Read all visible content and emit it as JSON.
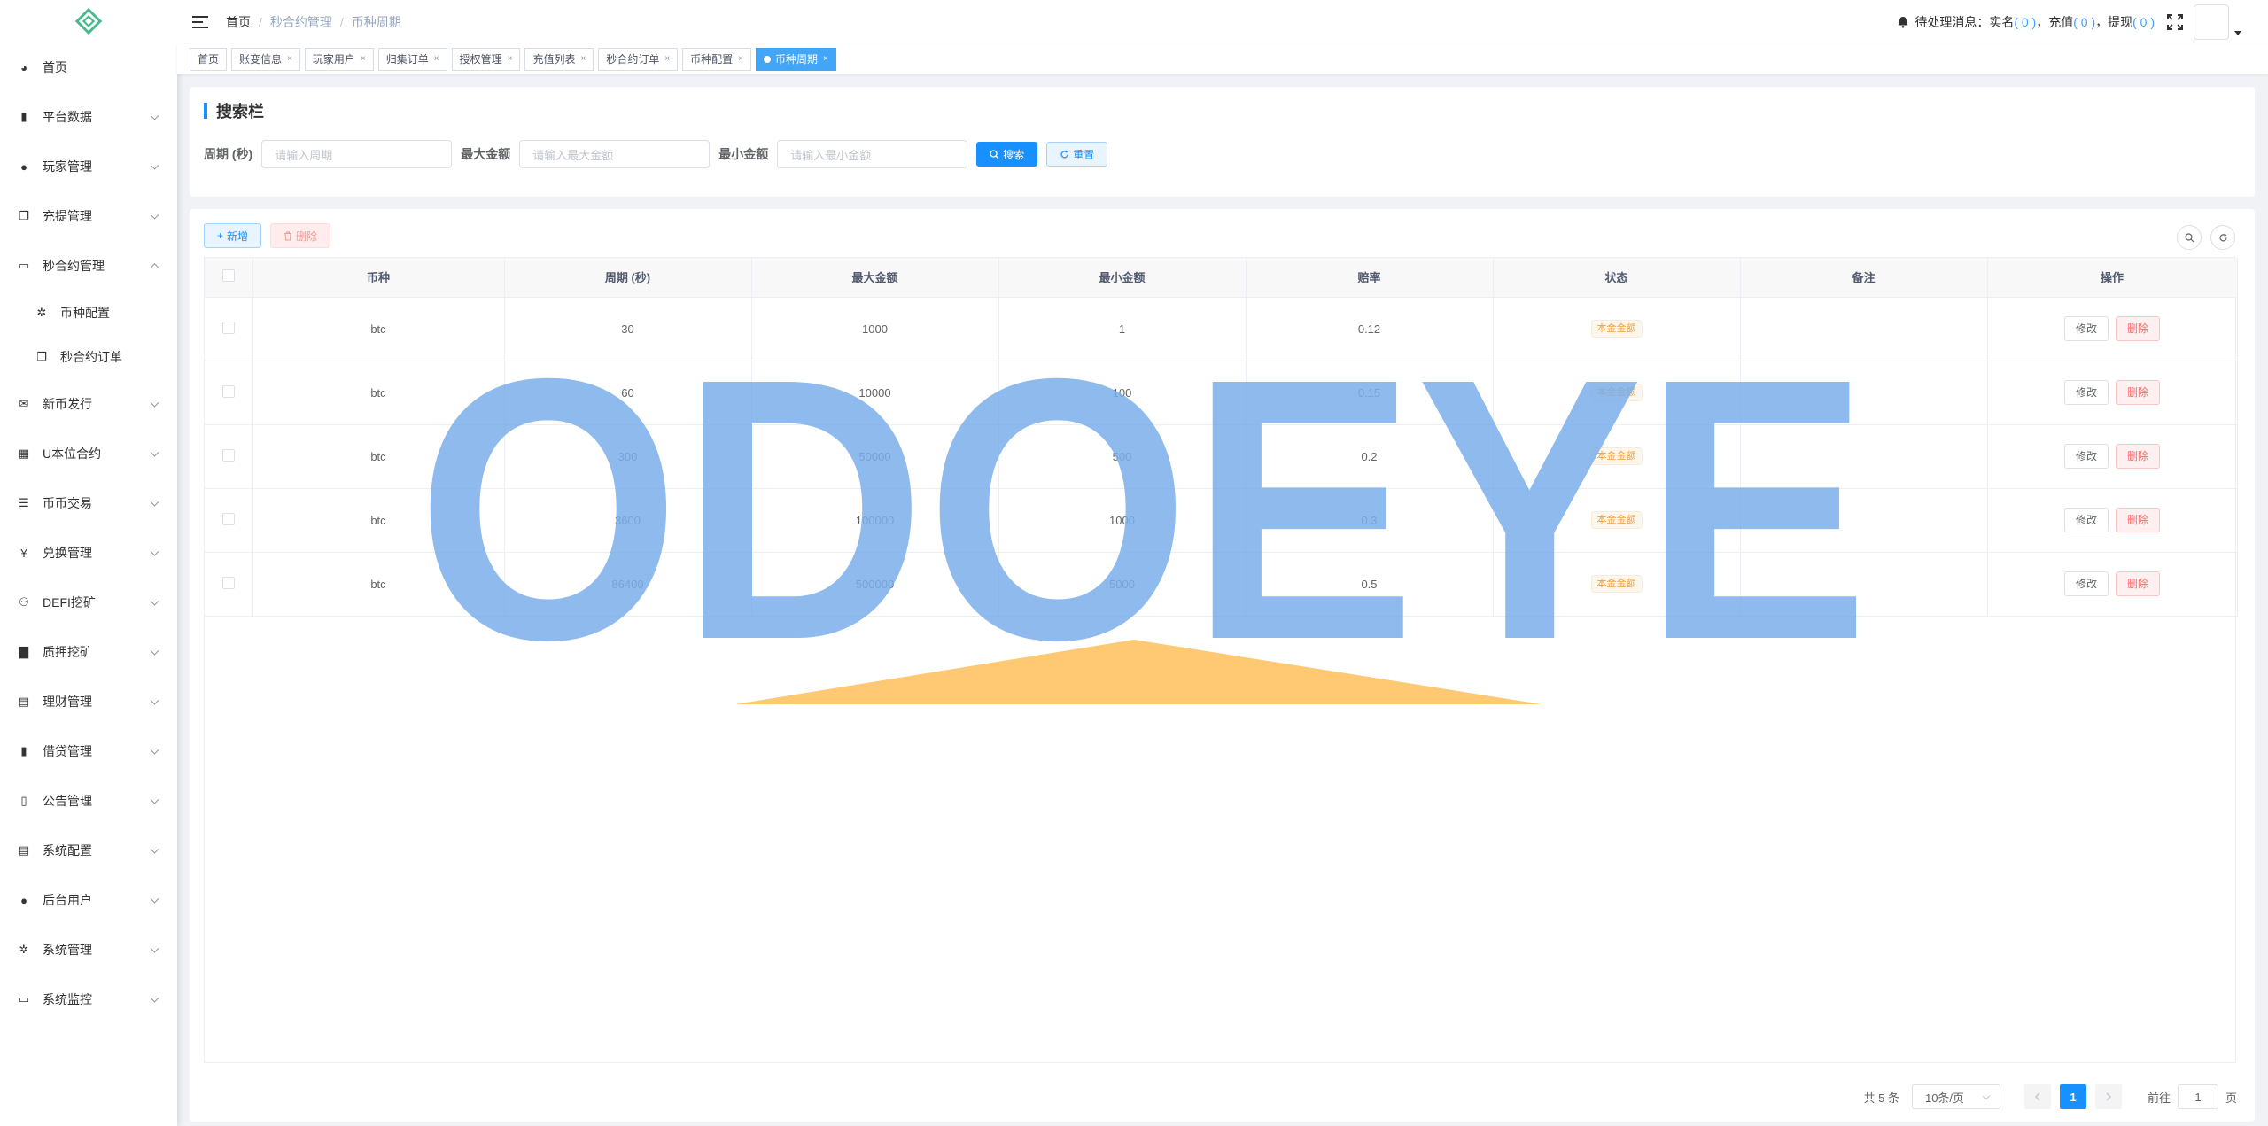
{
  "sidebar": {
    "items": [
      {
        "label": "首页",
        "icon": "dashboard-icon",
        "arrow": false
      },
      {
        "label": "平台数据",
        "icon": "chart-icon",
        "arrow": true
      },
      {
        "label": "玩家管理",
        "icon": "user-icon",
        "arrow": true
      },
      {
        "label": "充提管理",
        "icon": "documents-icon",
        "arrow": true
      },
      {
        "label": "秒合约管理",
        "icon": "monitor-icon",
        "arrow": true,
        "expanded": true
      }
    ],
    "sub_items": [
      {
        "label": "币种配置",
        "icon": "gear-outline-icon"
      },
      {
        "label": "秒合约订单",
        "icon": "documents-icon"
      }
    ],
    "items_after": [
      {
        "label": "新币发行",
        "icon": "message-icon"
      },
      {
        "label": "U本位合约",
        "icon": "grid-icon"
      },
      {
        "label": "币币交易",
        "icon": "list-icon"
      },
      {
        "label": "兑换管理",
        "icon": "yen-icon"
      },
      {
        "label": "DEFI挖矿",
        "icon": "people-icon"
      },
      {
        "label": "质押挖矿",
        "icon": "bar-chart-icon"
      },
      {
        "label": "理财管理",
        "icon": "form-icon"
      },
      {
        "label": "借贷管理",
        "icon": "money-icon"
      },
      {
        "label": "公告管理",
        "icon": "book-icon"
      },
      {
        "label": "系统配置",
        "icon": "doc-icon"
      },
      {
        "label": "后台用户",
        "icon": "users-icon"
      },
      {
        "label": "系统管理",
        "icon": "gear-icon"
      },
      {
        "label": "系统监控",
        "icon": "monitor-icon"
      }
    ]
  },
  "header": {
    "breadcrumb": [
      "首页",
      "秒合约管理",
      "币种周期"
    ],
    "pending_label": "待处理消息：实名",
    "realname_count": "( 0 )",
    "recharge_label": "，充值",
    "recharge_count": "( 0 )",
    "withdraw_label": "，提现",
    "withdraw_count": "( 0 )"
  },
  "tags": [
    {
      "label": "首页",
      "closable": false
    },
    {
      "label": "账变信息",
      "closable": true
    },
    {
      "label": "玩家用户",
      "closable": true
    },
    {
      "label": "归集订单",
      "closable": true
    },
    {
      "label": "授权管理",
      "closable": true
    },
    {
      "label": "充值列表",
      "closable": true
    },
    {
      "label": "秒合约订单",
      "closable": true
    },
    {
      "label": "币种配置",
      "closable": true
    },
    {
      "label": "币种周期",
      "closable": true,
      "active": true
    }
  ],
  "search": {
    "title": "搜索栏",
    "period_label": "周期 (秒)",
    "period_placeholder": "请输入周期",
    "max_label": "最大金额",
    "max_placeholder": "请输入最大金额",
    "min_label": "最小金额",
    "min_placeholder": "请输入最小金额",
    "search_btn": "搜索",
    "reset_btn": "重置"
  },
  "toolbar": {
    "add_btn": "新增",
    "delete_btn": "删除"
  },
  "table": {
    "columns": [
      "币种",
      "周期 (秒)",
      "最大金额",
      "最小金额",
      "赔率",
      "状态",
      "备注",
      "操作"
    ],
    "rows": [
      {
        "coin": "btc",
        "period": "30",
        "max": "1000",
        "min": "1",
        "odds": "0.12",
        "status": "本金金额",
        "remark": ""
      },
      {
        "coin": "btc",
        "period": "60",
        "max": "10000",
        "min": "100",
        "odds": "0.15",
        "status": "本金金额",
        "remark": ""
      },
      {
        "coin": "btc",
        "period": "300",
        "max": "50000",
        "min": "500",
        "odds": "0.2",
        "status": "本金金额",
        "remark": ""
      },
      {
        "coin": "btc",
        "period": "3600",
        "max": "100000",
        "min": "1000",
        "odds": "0.3",
        "status": "本金金额",
        "remark": ""
      },
      {
        "coin": "btc",
        "period": "86400",
        "max": "500000",
        "min": "5000",
        "odds": "0.5",
        "status": "本金金额",
        "remark": ""
      }
    ],
    "edit_label": "修改",
    "delete_label": "删除"
  },
  "pagination": {
    "total": "共 5 条",
    "page_size": "10条/页",
    "current_page": "1",
    "goto_label": "前往",
    "goto_value": "1",
    "page_suffix": "页"
  },
  "watermark": {
    "text": "ODOEYE",
    "colors": {
      "letters": "#7aaeea",
      "roof": "#fec66a"
    }
  },
  "colors": {
    "primary": "#1890ff",
    "tag_active": "#42a5f5",
    "warning": "#e6a23c",
    "danger": "#f56c6c"
  }
}
